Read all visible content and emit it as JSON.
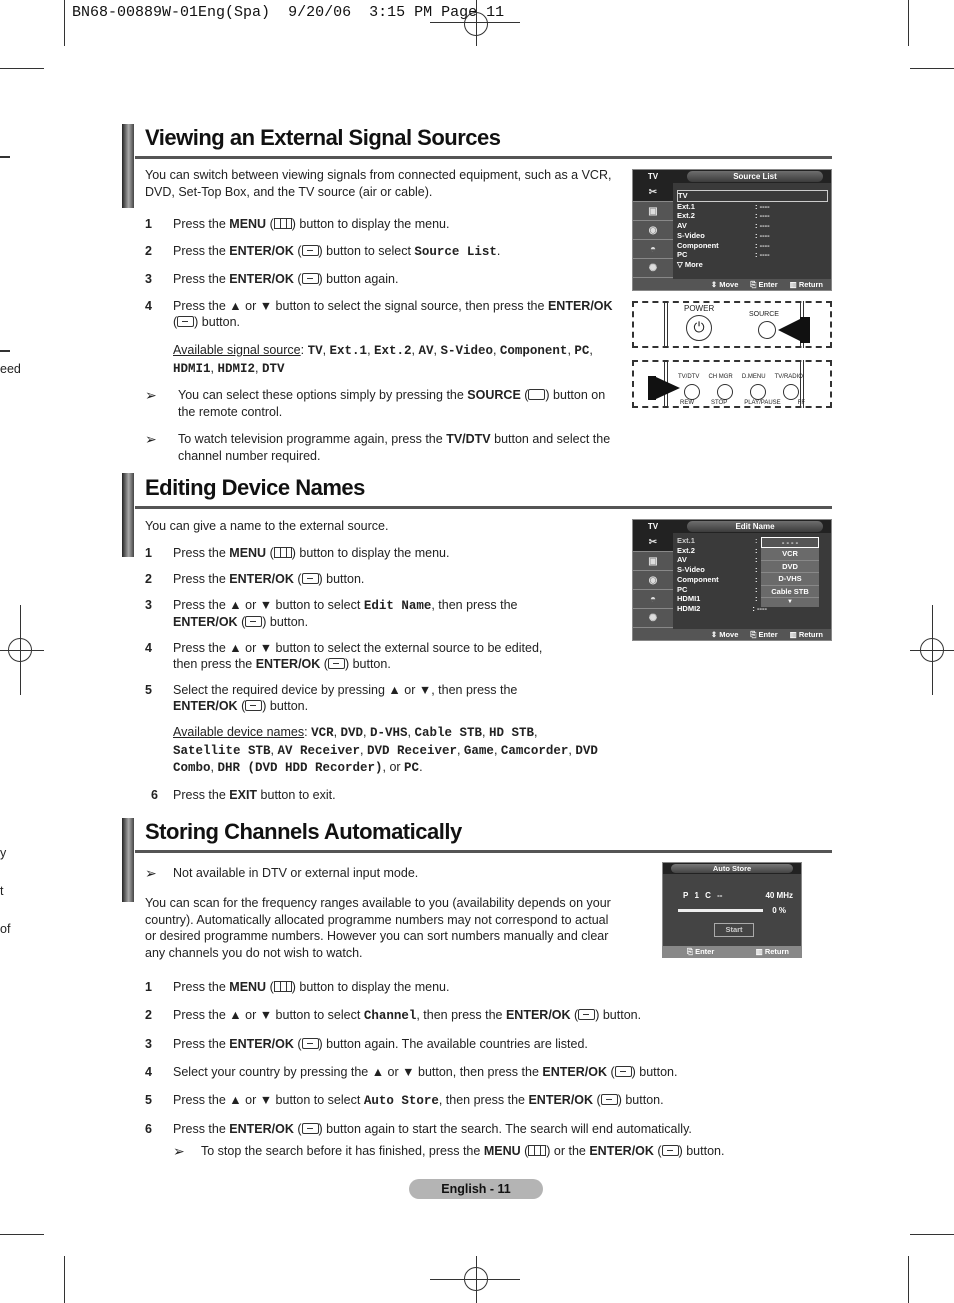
{
  "print_header": {
    "job": "BN68-00889W-01Eng(Spa)",
    "date": "9/20/06",
    "time": "3:15 PM",
    "page": "Page 11"
  },
  "margin_fragments": [
    "eed",
    "y",
    "t",
    "of"
  ],
  "sections": [
    {
      "title": "Viewing an External Signal Sources",
      "intro": "You can switch between viewing signals from connected equipment, such as a VCR, DVD, Set-Top Box, and the TV source (air or cable).",
      "steps": [
        {
          "num": "1",
          "pre": "Press the ",
          "bold": "MENU",
          "mid": " (",
          "icon": "menu-icon",
          "post": ") button to display the menu."
        },
        {
          "num": "2",
          "pre": "Press the ",
          "bold": "ENTER/OK",
          "mid": " (",
          "icon": "enter-icon",
          "post": ") button to select ",
          "code": "Source List",
          "end": "."
        },
        {
          "num": "3",
          "pre": "Press the ",
          "bold": "ENTER/OK",
          "mid": " (",
          "icon": "enter-icon",
          "post": ") button again."
        },
        {
          "num": "4",
          "pre": "Press the ▲ or ▼ button to select the signal source, then press the ",
          "bold": "ENTER/OK",
          "mid": " (",
          "icon": "enter-icon",
          "post": ") button."
        }
      ],
      "available_label": "Available signal source",
      "available": [
        "TV",
        "Ext.1",
        "Ext.2",
        "AV",
        "S-Video",
        "Component",
        "PC",
        "HDMI1",
        "HDMI2",
        "DTV"
      ],
      "notes": [
        {
          "pre": "You can select these options simply by pressing the ",
          "bold": "SOURCE",
          "post": ") button on the remote control."
        },
        {
          "pre": "To watch television programme again, press the ",
          "bold": "TV/DTV",
          "post": " button and select the channel number required."
        }
      ]
    },
    {
      "title": "Editing Device Names",
      "intro": "You can give a name to the external source.",
      "steps": [
        {
          "num": "1",
          "pre": "Press the ",
          "bold": "MENU",
          "post": ") button to display the menu."
        },
        {
          "num": "2",
          "pre": "Press the ",
          "bold": "ENTER/OK",
          "post": ") button."
        },
        {
          "num": "3",
          "pre": "Press the ▲ or ▼ button to select ",
          "code": "Edit Name",
          "mid": ", then press the ",
          "bold": "ENTER/OK",
          "post": ") button."
        },
        {
          "num": "4",
          "pre": "Press the ▲ or ▼ button to select the external source to be edited, then press the ",
          "bold": "ENTER/OK",
          "post": ") button."
        },
        {
          "num": "5",
          "pre": "Select the required device by pressing ▲ or ▼, then press the ",
          "bold": "ENTER/OK",
          "post": ") button."
        },
        {
          "num": "6",
          "pre": "Press the ",
          "bold": "EXIT",
          "post": " button to exit."
        }
      ],
      "available_label": "Available device names",
      "available": [
        "VCR",
        "DVD",
        "D-VHS",
        "Cable STB",
        "HD STB",
        "Satellite STB",
        "AV Receiver",
        "DVD Receiver",
        "Game",
        "Camcorder",
        "DVD Combo",
        "DHR (DVD HDD Recorder)"
      ],
      "available_last": "PC",
      "or_text": "or"
    },
    {
      "title": "Storing Channels Automatically",
      "note_top": "Not available in DTV or external input mode.",
      "intro": "You can scan for the frequency ranges available to you (availability depends on your country). Automatically allocated programme numbers may not correspond to actual or desired programme numbers. However you can sort numbers manually and clear any channels you do not wish to watch.",
      "steps": [
        {
          "num": "1",
          "pre": "Press the ",
          "bold": "MENU",
          "post": ") button to display the menu."
        },
        {
          "num": "2",
          "pre": "Press the ▲ or ▼ button to select ",
          "code": "Channel",
          "mid": ", then press the ",
          "bold": "ENTER/OK",
          "post": ") button."
        },
        {
          "num": "3",
          "pre": "Press the ",
          "bold": "ENTER/OK",
          "post": ") button again. The available countries are listed."
        },
        {
          "num": "4",
          "pre": "Select your country by pressing the ▲ or ▼ button, then press the ",
          "bold": "ENTER/OK",
          "post": ") button."
        },
        {
          "num": "5",
          "pre": "Press the ▲ or ▼ button to select ",
          "code": "Auto Store",
          "mid": ", then press the ",
          "bold": "ENTER/OK",
          "post": ") button."
        },
        {
          "num": "6",
          "pre": "Press the ",
          "bold": "ENTER/OK",
          "post": ") button again to start the search. The search will end automatically."
        }
      ],
      "note_bottom": {
        "pre": "To stop the search before it has finished, press the ",
        "bold1": "MENU",
        "mid": ") or the ",
        "bold2": "ENTER/OK",
        "post": ") button."
      }
    }
  ],
  "osd_source_list": {
    "tab": "TV",
    "title": "Source List",
    "rows": [
      {
        "name": "TV",
        "value": ""
      },
      {
        "name": "Ext.1",
        "value": ": ----"
      },
      {
        "name": "Ext.2",
        "value": ": ----"
      },
      {
        "name": "AV",
        "value": ": ----"
      },
      {
        "name": "S-Video",
        "value": ": ----"
      },
      {
        "name": "Component",
        "value": ": ----"
      },
      {
        "name": "PC",
        "value": ": ----"
      }
    ],
    "more": "▽ More",
    "footer": [
      "⇕ Move",
      "⎘ Enter",
      "▥ Return"
    ]
  },
  "remote_top": {
    "power": "POWER",
    "source": "SOURCE"
  },
  "remote_bottom": {
    "labels": [
      "TV/DTV",
      "CH MGR",
      "D.MENU",
      "TV/RADIO"
    ],
    "labels2": [
      "REW",
      "STOP",
      "PLAY/PAUSE",
      "FF"
    ]
  },
  "osd_edit_name": {
    "tab": "TV",
    "title": "Edit Name",
    "rows": [
      "Ext.1",
      "Ext.2",
      "AV",
      "S-Video",
      "Component",
      "PC",
      "HDMI1",
      "HDMI2"
    ],
    "hdmi2_value": ": ----",
    "dropdown": [
      "- - - -",
      "VCR",
      "DVD",
      "D-VHS",
      "Cable STB",
      "▼"
    ],
    "footer": [
      "⇕ Move",
      "⎘ Enter",
      "▥ Return"
    ]
  },
  "osd_auto_store": {
    "title": "Auto Store",
    "p_label": "P",
    "p_value": "1",
    "c_label": "C",
    "c_value": "--",
    "freq": "40 MHz",
    "progress_pct": "0 %",
    "progress": 0,
    "start": "Start",
    "footer_enter": "⎘ Enter",
    "footer_return": "▥ Return"
  },
  "page_footer": "English - 11"
}
